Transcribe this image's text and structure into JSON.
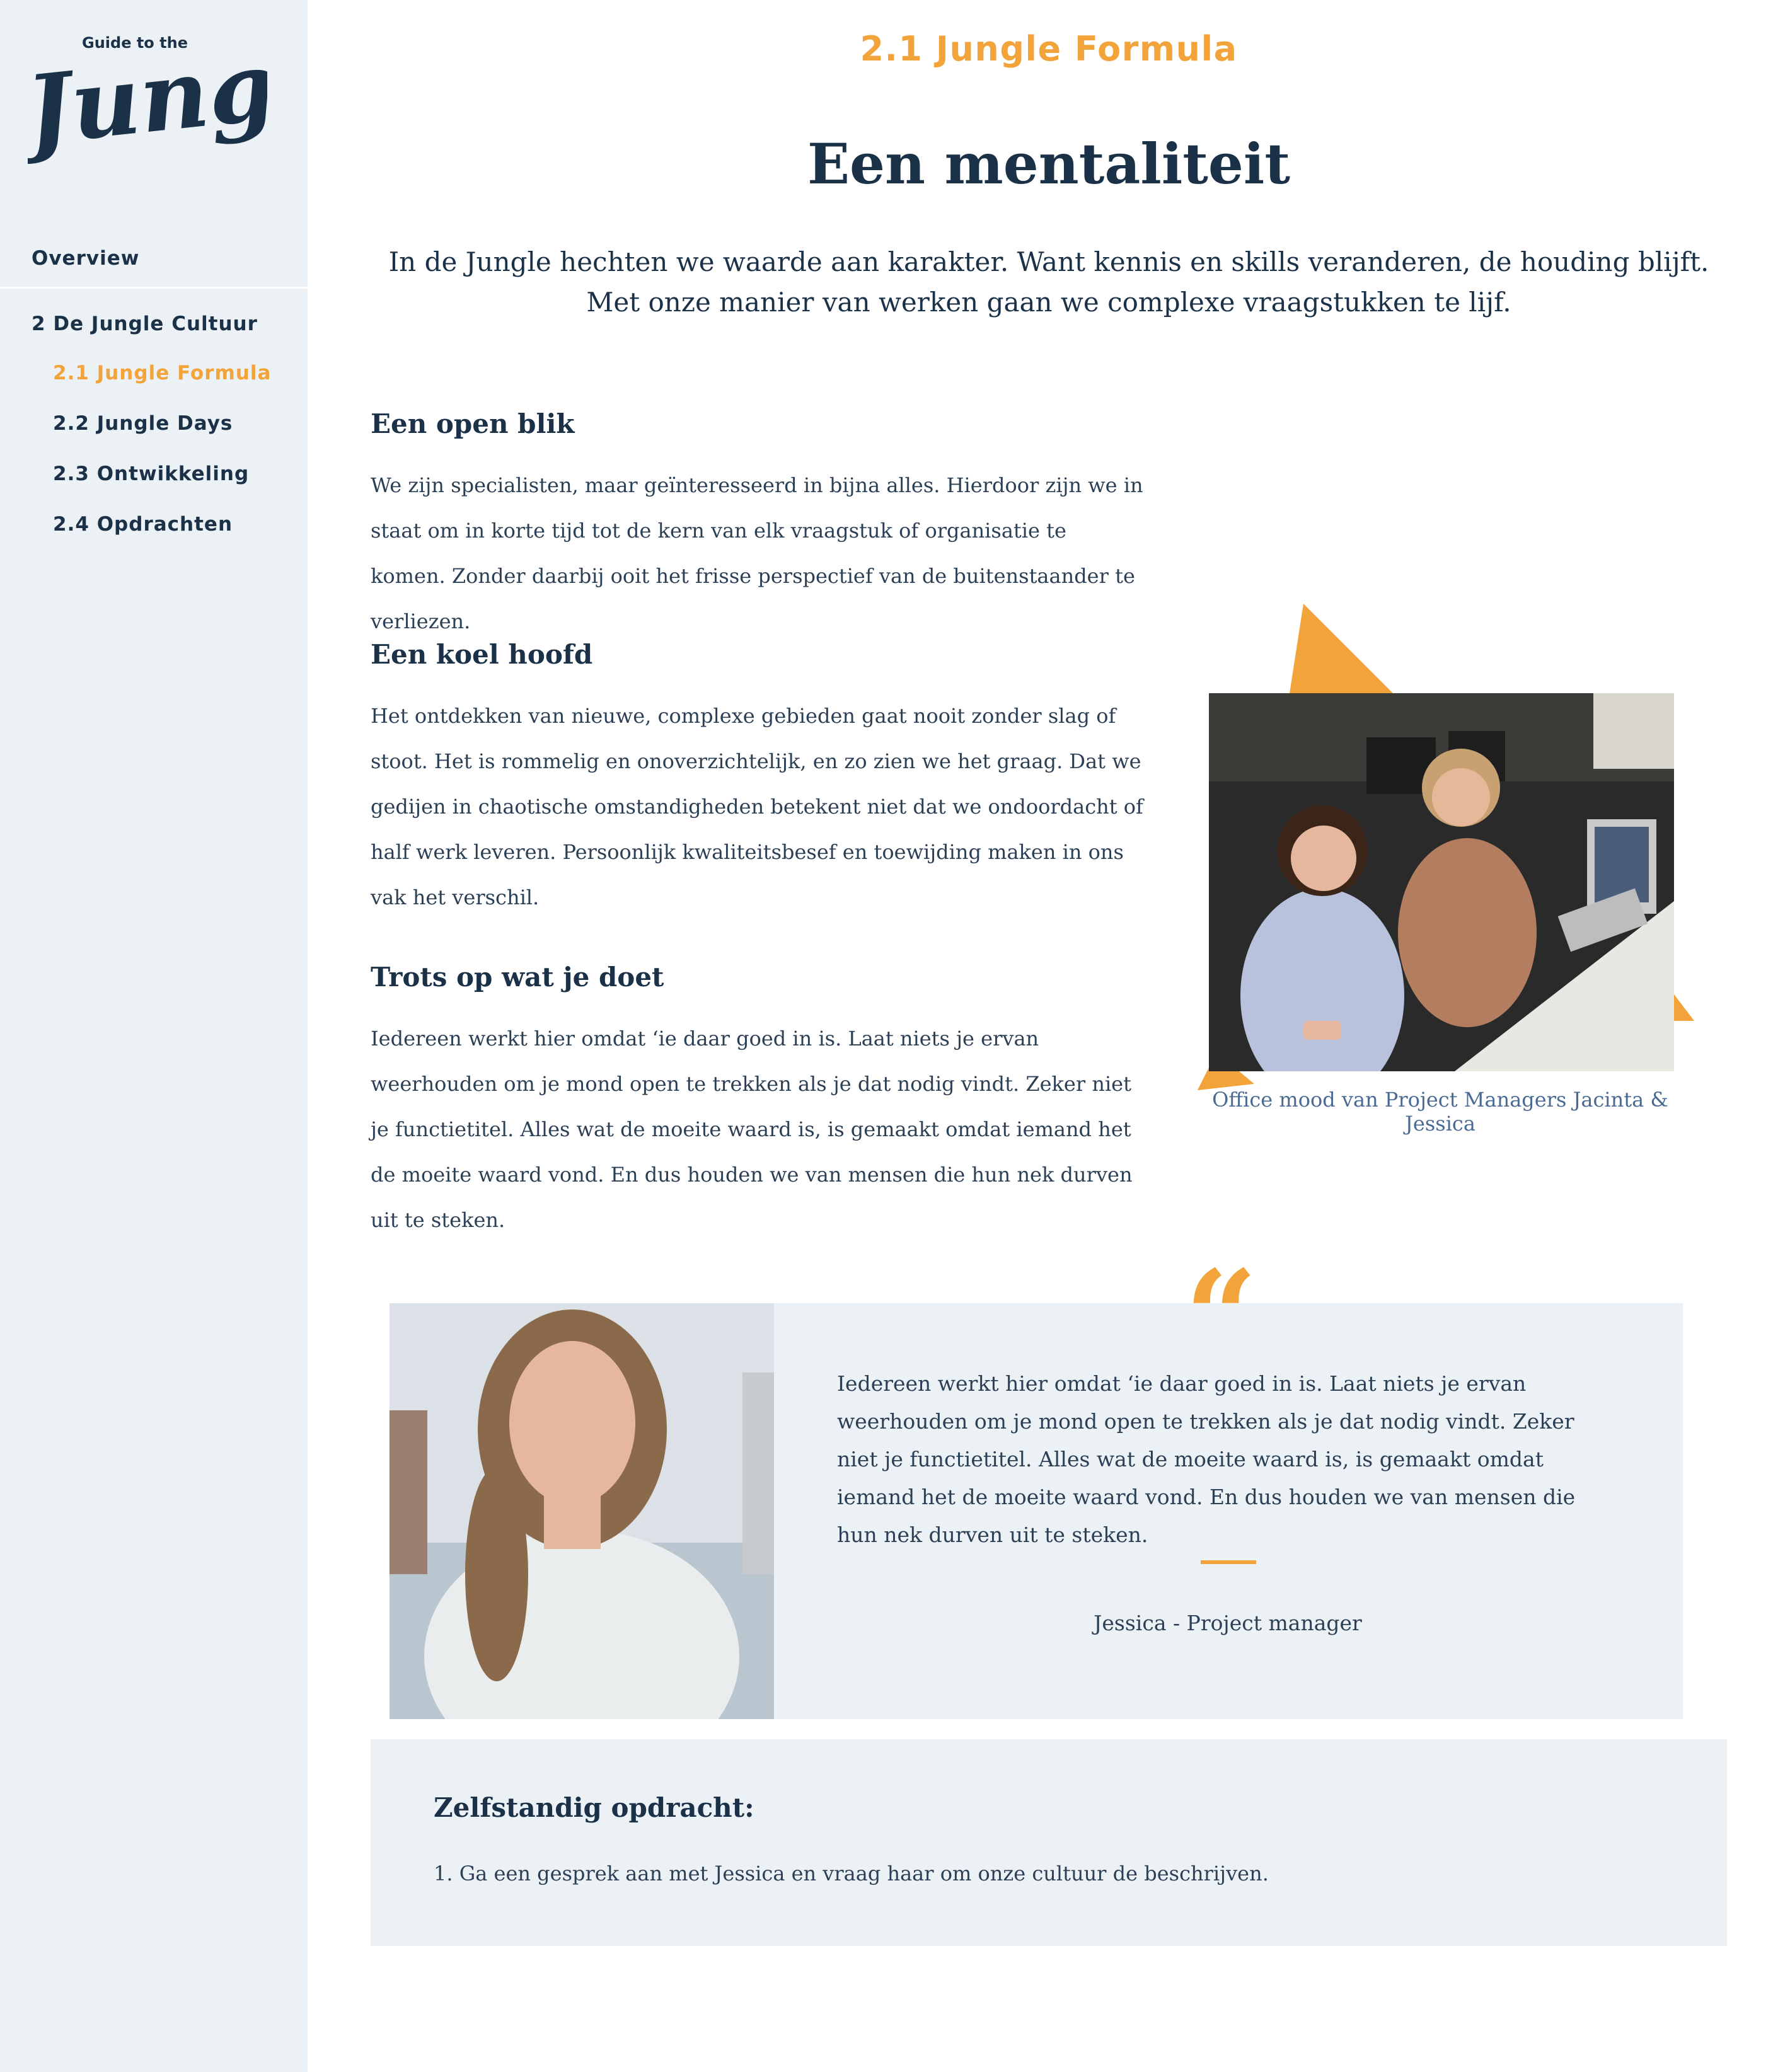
{
  "sidebar": {
    "logo_small": "Guide to the",
    "logo_big": "Jungle",
    "overview": "Overview",
    "section": "2 De Jungle Cultuur",
    "items": [
      {
        "label": "2.1 Jungle Formula",
        "active": true
      },
      {
        "label": "2.2 Jungle Days",
        "active": false
      },
      {
        "label": "2.3 Ontwikkeling",
        "active": false
      },
      {
        "label": "2.4 Opdrachten",
        "active": false
      }
    ]
  },
  "header": {
    "kicker": "2.1 Jungle Formula",
    "title": "Een mentaliteit",
    "intro_line1": "In de Jungle hechten we waarde aan karakter. Want kennis en skills veranderen, de houding blijft.",
    "intro_line2": "Met onze manier van werken gaan we complexe vraagstukken te lijf."
  },
  "sections": [
    {
      "heading": "Een open blik",
      "body": "We zijn specialisten, maar geïnteresseerd in bijna alles. Hierdoor zijn we in staat om in korte tijd tot de kern van elk vraagstuk of organisatie te komen. Zonder daarbij ooit het frisse perspectief van de buitenstaander te verliezen."
    },
    {
      "heading": "Een koel hoofd",
      "body": "Het ontdekken van nieuwe, complexe gebieden gaat nooit zonder slag of stoot. Het is rommelig en onoverzichtelijk, en zo zien we het graag. Dat we gedijen in chaotische omstandigheden betekent niet dat we ondoordacht of half werk leveren. Persoonlijk kwaliteitsbesef en toewijding maken in ons vak het verschil."
    },
    {
      "heading": "Trots op wat je doet",
      "body": "Iedereen werkt hier omdat ‘ie daar goed in is. Laat niets je ervan weerhouden om je mond open te trekken als je dat nodig vindt. Zeker niet je functietitel. Alles wat de moeite waard is, is gemaakt omdat iemand het de moeite waard vond. En dus houden we van mensen die hun nek durven uit te steken."
    }
  ],
  "photo": {
    "caption": "Office mood van Project Managers Jacinta & Jessica"
  },
  "quote": {
    "mark": "“",
    "text": "Iedereen werkt hier omdat ‘ie daar goed in is. Laat niets je ervan weerhouden om je mond open te trekken als je dat nodig vindt. Zeker niet je functietitel. Alles wat de moeite waard is, is gemaakt omdat iemand het de moeite waard vond. En dus houden we van mensen die hun nek durven uit te steken.",
    "author": "Jessica - Project manager"
  },
  "assignment": {
    "title": "Zelfstandig opdracht:",
    "item": "1. Ga een gesprek aan met Jessica en vraag haar om onze cultuur de beschrijven."
  },
  "colors": {
    "accent": "#f2a33a",
    "navy": "#1a3147",
    "panel": "#ecf1f6",
    "caption": "#4a6a94"
  }
}
